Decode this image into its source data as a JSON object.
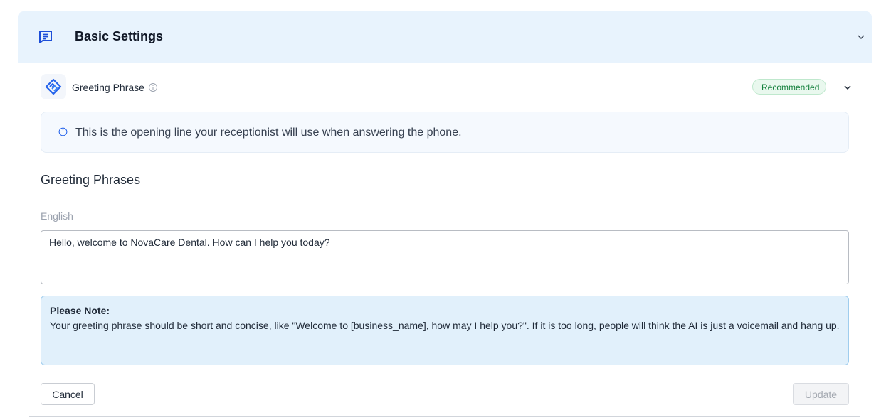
{
  "header": {
    "title": "Basic Settings"
  },
  "greeting_row": {
    "label": "Greeting Phrase",
    "badge": "Recommended"
  },
  "info": {
    "text": "This is the opening line your receptionist will use when answering the phone."
  },
  "section": {
    "title": "Greeting Phrases",
    "language_label": "English"
  },
  "greeting_input": {
    "value": "Hello, welcome to NovaCare Dental. How can I help you today?"
  },
  "note": {
    "title": "Please Note:",
    "body": "Your greeting phrase should be short and concise, like \"Welcome to [business_name], how may I help you?\". If it is too long, people will think the AI is just a voicemail and hang up."
  },
  "actions": {
    "cancel_label": "Cancel",
    "update_label": "Update"
  },
  "colors": {
    "header_bg": "#e8f3fd",
    "accent_blue": "#1d4ed8",
    "badge_green": "#15803d",
    "note_bg": "#e1f0fb"
  },
  "icons": {
    "header": "message-square-icon",
    "greeting_logo": "handshake-icon",
    "info": "info-circle-icon",
    "collapse": "chevron-down-icon"
  }
}
